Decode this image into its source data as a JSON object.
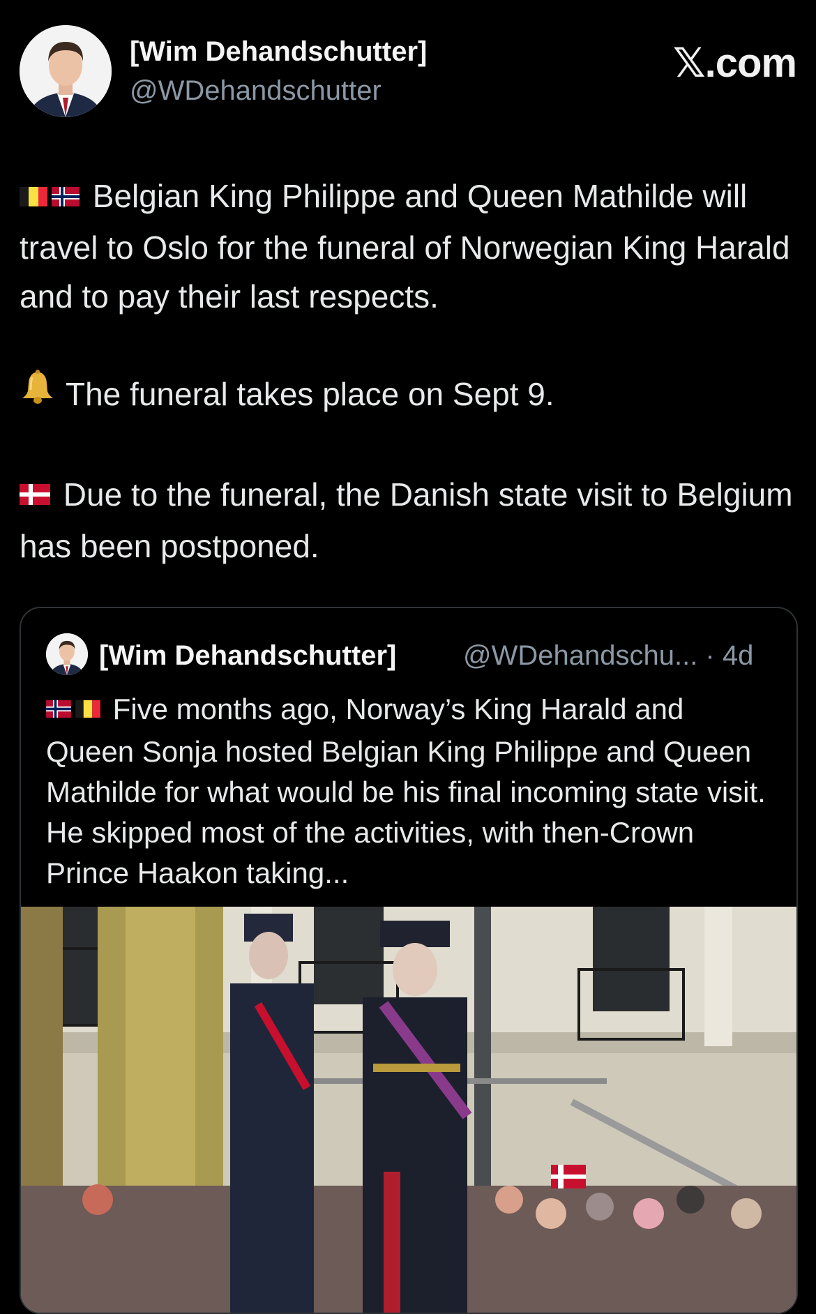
{
  "author": {
    "name": "[Wim Dehandschutter]",
    "handle": "@WDehandschutter"
  },
  "brand": "𝕏.com",
  "tweet": {
    "para1": "Belgian King Philippe and Queen Mathilde will travel to Oslo for the funeral of Norwegian King Harald and to pay their last respects.",
    "para2": "The funeral takes place on Sept 9.",
    "para3": "Due to the funeral, the Danish state visit to Belgium has been postponed."
  },
  "quote": {
    "name": "[Wim Dehandschutter]",
    "meta": "@WDehandschu... · 4d",
    "text": "Five months ago, Norway’s King Harald and Queen Sonja hosted Belgian King Philippe and Queen Mathilde for what would be his final incoming state visit. He skipped most of the activities, with then-Crown Prince Haakon taking..."
  },
  "icons": {
    "flag_be": "belgium-flag-icon",
    "flag_no": "norway-flag-icon",
    "flag_dk": "denmark-flag-icon",
    "bell": "bell-icon"
  },
  "colors": {
    "background": "#000000",
    "text": "#e7e9ea",
    "muted": "#8b98a5",
    "border": "#2f3336"
  }
}
